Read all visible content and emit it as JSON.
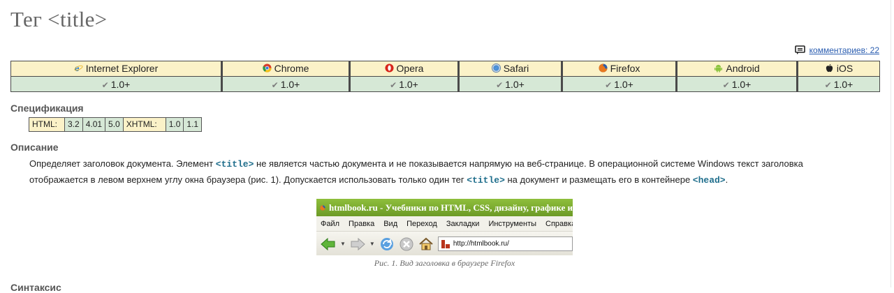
{
  "page": {
    "title": "Тег <title>",
    "comments_label": "комментариев: 22"
  },
  "browsers": [
    {
      "name": "Internet Explorer",
      "version": "1.0+",
      "icon": "internet-explorer-icon"
    },
    {
      "name": "Chrome",
      "version": "1.0+",
      "icon": "chrome-icon"
    },
    {
      "name": "Opera",
      "version": "1.0+",
      "icon": "opera-icon"
    },
    {
      "name": "Safari",
      "version": "1.0+",
      "icon": "safari-icon"
    },
    {
      "name": "Firefox",
      "version": "1.0+",
      "icon": "firefox-icon"
    },
    {
      "name": "Android",
      "version": "1.0+",
      "icon": "android-icon"
    },
    {
      "name": "iOS",
      "version": "1.0+",
      "icon": "apple-icon"
    }
  ],
  "spec": {
    "heading": "Спецификация",
    "html_label": "HTML:",
    "html_versions": [
      "3.2",
      "4.01",
      "5.0"
    ],
    "xhtml_label": "XHTML:",
    "xhtml_versions": [
      "1.0",
      "1.1"
    ]
  },
  "description": {
    "heading": "Описание",
    "p1_a": "Определяет заголовок документа. Элемент ",
    "code1": "<title>",
    "p1_b": " не является частью документа и не показывается напрямую на веб-странице. В операционной системе Windows текст заголовка отображается в левом верхнем углу окна браузера (рис. 1). Допускается использовать только один тег ",
    "code2": "<title>",
    "p1_c": " на документ и размещать его в контейнере ",
    "code3": "<head>",
    "p1_d": "."
  },
  "figure": {
    "window_title": "htmlbook.ru - Учебники по HTML, CSS, дизайну, графике и",
    "menu": [
      "Файл",
      "Правка",
      "Вид",
      "Переход",
      "Закладки",
      "Инструменты",
      "Справка"
    ],
    "url": "http://htmlbook.ru/",
    "caption": "Рис. 1. Вид заголовка в браузере Firefox"
  },
  "next_heading": "Синтаксис",
  "colors": {
    "name_row_bg": "#fbf2c8",
    "version_row_bg": "#d6e8d6",
    "code_color": "#1f6e8c",
    "link_color": "#2a5db0"
  }
}
